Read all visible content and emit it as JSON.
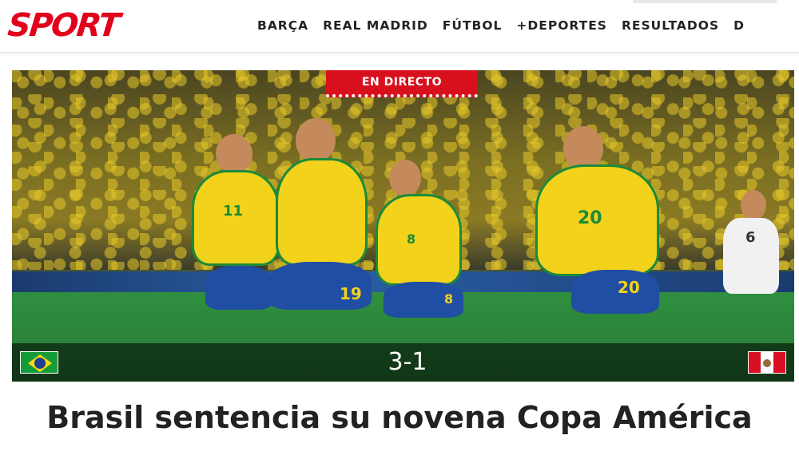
{
  "header": {
    "logo": "SPORT",
    "nav": [
      "BARÇA",
      "REAL MADRID",
      "FÚTBOL",
      "+DEPORTES",
      "RESULTADOS",
      "D"
    ]
  },
  "hero": {
    "live_badge": "EN DIRECTO",
    "home_flag": "brazil-flag-icon",
    "away_flag": "peru-flag-icon",
    "score": "3-1",
    "jersey_numbers": [
      "11",
      "8",
      "19",
      "20",
      "20",
      "8",
      "6"
    ]
  },
  "article": {
    "headline": "Brasil sentencia su novena Copa América"
  },
  "colors": {
    "brand_red": "#e2001a",
    "live_red": "#d8101e",
    "text_dark": "#222222"
  }
}
